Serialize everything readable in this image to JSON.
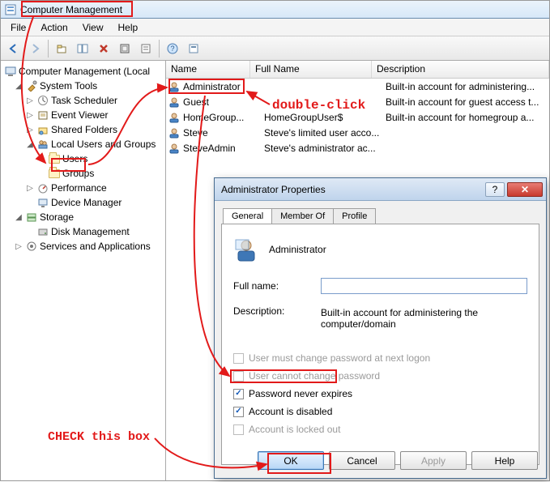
{
  "window": {
    "title": "Computer Management"
  },
  "menu": {
    "file": "File",
    "action": "Action",
    "view": "View",
    "help": "Help"
  },
  "toolbar_icons": [
    "back",
    "forward",
    "up",
    "show-hide",
    "delete",
    "refresh",
    "export",
    "help-alt"
  ],
  "tree": {
    "root": "Computer Management (Local",
    "system_tools": "System Tools",
    "task_scheduler": "Task Scheduler",
    "event_viewer": "Event Viewer",
    "shared_folders": "Shared Folders",
    "local_users": "Local Users and Groups",
    "users": "Users",
    "groups": "Groups",
    "performance": "Performance",
    "device_manager": "Device Manager",
    "storage": "Storage",
    "disk_management": "Disk Management",
    "services_apps": "Services and Applications"
  },
  "list": {
    "col_name": "Name",
    "col_full": "Full Name",
    "col_desc": "Description",
    "rows": [
      {
        "name": "Administrator",
        "full": "",
        "desc": "Built-in account for administering..."
      },
      {
        "name": "Guest",
        "full": "",
        "desc": "Built-in account for guest access t..."
      },
      {
        "name": "HomeGroup...",
        "full": "HomeGroupUser$",
        "desc": "Built-in account for homegroup a..."
      },
      {
        "name": "Steve",
        "full": "Steve's limited user acco...",
        "desc": ""
      },
      {
        "name": "SteveAdmin",
        "full": "Steve's administrator ac...",
        "desc": ""
      }
    ]
  },
  "dialog": {
    "title": "Administrator Properties",
    "tabs": {
      "general": "General",
      "member_of": "Member Of",
      "profile": "Profile"
    },
    "heading": "Administrator",
    "full_name_label": "Full name:",
    "full_name_value": "",
    "description_label": "Description:",
    "description_value": "Built-in account for administering the computer/domain",
    "chk_must_change": "User must change password at next logon",
    "chk_cannot_change": "User cannot change password",
    "chk_never_expires": "Password never expires",
    "chk_disabled": "Account is disabled",
    "chk_locked": "Account is locked out",
    "buttons": {
      "ok": "OK",
      "cancel": "Cancel",
      "apply": "Apply",
      "help": "Help"
    }
  },
  "annotations": {
    "double_click": "double-click",
    "check_box": "CHECK this box"
  }
}
